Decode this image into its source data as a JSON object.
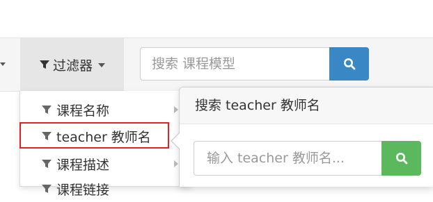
{
  "toolbar": {
    "filter_label": "过滤器",
    "search_placeholder": "搜索 课程模型"
  },
  "filter_menu": {
    "items": [
      {
        "label": "课程名称"
      },
      {
        "label": "teacher 教师名"
      },
      {
        "label": "课程描述"
      },
      {
        "label": "课程链接"
      }
    ]
  },
  "popover": {
    "title": "搜索 teacher 教师名",
    "input_placeholder": "输入 teacher 教师名..."
  },
  "colors": {
    "search_button": "#3a87c6",
    "popover_search_button": "#5cb85c",
    "highlight": "#e02222"
  },
  "icons": [
    "filter-icon",
    "caret-down-icon",
    "search-icon",
    "caret-right-icon"
  ]
}
